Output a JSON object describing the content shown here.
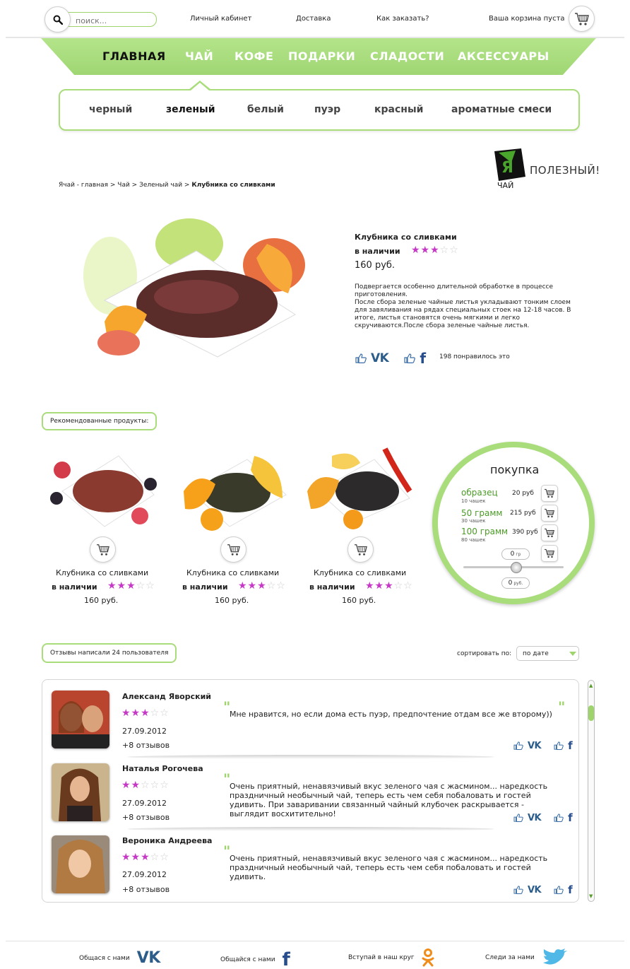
{
  "header": {
    "search_placeholder": "поиск...",
    "links": [
      "Личный кабинет",
      "Доставка",
      "Как заказать?"
    ],
    "cart_status": "Ваша корзина пуста"
  },
  "main_nav": {
    "items": [
      "ГЛАВНАЯ",
      "ЧАЙ",
      "КОФЕ",
      "ПОДАРКИ",
      "СЛАДОСТИ",
      "АКСЕССУАРЫ"
    ],
    "active_index": 0
  },
  "sub_nav": {
    "items": [
      "черный",
      "зеленый",
      "белый",
      "пуэр",
      "красный",
      "ароматные смеси"
    ],
    "active_index": 1
  },
  "logo": {
    "mark": "Я",
    "small": "ЧАЙ",
    "text": "ПОЛЕЗНЫЙ!"
  },
  "breadcrumb": {
    "path": "Ячай - главная > Чай > Зеленый чай >",
    "current": "Клубника со сливками"
  },
  "product": {
    "title": "Клубника со сливками",
    "stock": "в наличии",
    "rating": 3,
    "rating_max": 5,
    "price": "160 руб.",
    "description": "Подвергается особенно длительной обработке в процессе приготовления.\nПосле сбора зеленые чайные листья укладывают тонким слоем  для завяливания на рядах специальных стоек на 12-18 часов. В итоге, листья становятся очень мягкими и легко скручиваются.После сбора зеленые чайные листья.",
    "vk_label": "VK",
    "fb_label": "f",
    "likes_text": "198 понравилось это"
  },
  "recommended": {
    "heading": "Рекомендованные продукты:",
    "items": [
      {
        "name": "Клубника со сливками",
        "stock": "в наличии",
        "rating": 3,
        "price": "160 руб."
      },
      {
        "name": "Клубника со сливками",
        "stock": "в наличии",
        "rating": 3,
        "price": "160 руб."
      },
      {
        "name": "Клубника со сливками",
        "stock": "в наличии",
        "rating": 3,
        "price": "160 руб."
      }
    ]
  },
  "purchase": {
    "title": "покупка",
    "options": [
      {
        "name": "образец",
        "sub": "10 чашек",
        "price": "20 руб"
      },
      {
        "name": "50 грамм",
        "sub": "30 чашек",
        "price": "215 руб"
      },
      {
        "name": "100 грамм",
        "sub": "80 чашек",
        "price": "390 руб"
      }
    ],
    "grams_value": "0",
    "grams_unit": "гр",
    "rub_value": "0",
    "rub_unit": "руб.",
    "slider_level": 0.5
  },
  "reviews": {
    "heading": "Отзывы написали 24 пользователя",
    "sort_label": "сортировать по:",
    "sort_value": "по дате",
    "items": [
      {
        "name": "Александ Яворский",
        "rating": 3,
        "date": "27.09.2012",
        "count": "+8 отзывов",
        "text": "Мне нравится, но если дома есть пуэр, предпочтение отдам все же второму))"
      },
      {
        "name": "Наталья Рогочева",
        "rating": 2,
        "date": "27.09.2012",
        "count": "+8 отзывов",
        "text": "Очень приятный, ненавязчивый вкус зеленого чая с жасмином... наредкость праздничный необычный чай, теперь есть чем себя побаловать и гостей удивить. При заваривании связанный чайный клубочек раскрывается - выглядит восхитительно!"
      },
      {
        "name": "Вероника Андреева",
        "rating": 3,
        "date": "27.09.2012",
        "count": "+8 отзывов",
        "text": "Очень приятный, ненавязчивый вкус зеленого чая с жасмином... наредкость праздничный необычный чай, теперь есть чем себя побаловать и гостей удивить."
      }
    ]
  },
  "footer": {
    "items": [
      {
        "text": "Общася с нами",
        "icon": "VK"
      },
      {
        "text": "Общайся с нами",
        "icon": "f"
      },
      {
        "text": "Вступай в наш круг",
        "icon": "odnoklassniki-icon"
      },
      {
        "text": "Следи за нами",
        "icon": "twitter-bird-icon"
      }
    ]
  },
  "colors": {
    "accent_green": "#a9dc7b",
    "star": "#c638c6",
    "vk": "#2b5c8a",
    "facebook": "#274d8c"
  }
}
